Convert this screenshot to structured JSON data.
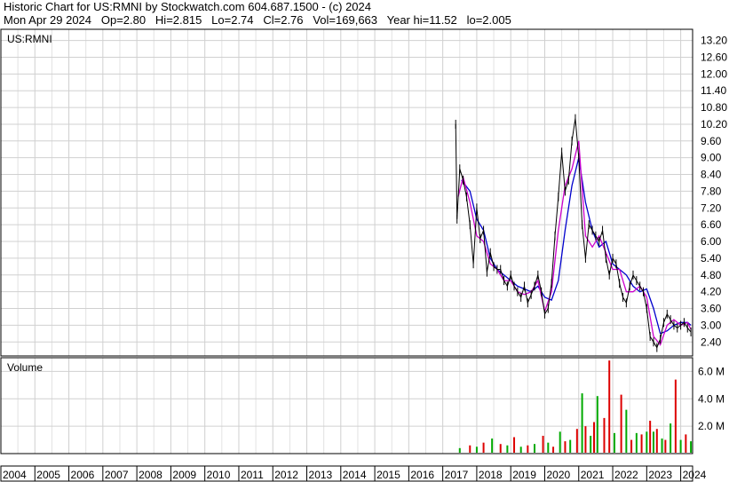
{
  "header": {
    "line1": "Historic Chart for US:RMNI by Stockwatch.com 604.687.1500 - (c) 2024",
    "line2": "Mon Apr 29 2024   Op=2.80   Hi=2.815   Lo=2.74   Cl=2.76   Vol=169,663   Year hi=11.52   lo=2.005"
  },
  "chart_data": [
    {
      "type": "line",
      "title": "US:RMNI",
      "y_ticks": [
        "13.20",
        "12.60",
        "12.00",
        "11.40",
        "10.80",
        "10.20",
        "9.60",
        "9.00",
        "8.40",
        "7.80",
        "7.20",
        "6.60",
        "6.00",
        "5.40",
        "4.80",
        "4.20",
        "3.60",
        "3.00",
        "2.40"
      ],
      "ylim": [
        1.9,
        13.6
      ],
      "x_ticks": [
        "2004",
        "2005",
        "2006",
        "2007",
        "2008",
        "2009",
        "2010",
        "2011",
        "2012",
        "2013",
        "2014",
        "2015",
        "2016",
        "2017",
        "2018",
        "2019",
        "2020",
        "2021",
        "2022",
        "2023",
        "2024"
      ],
      "xlim": [
        2004.0,
        2024.35
      ],
      "colors": {
        "price": "#000000",
        "ma_fast": "#cc00cc",
        "ma_slow": "#0000cc"
      },
      "series": [
        {
          "key": "price",
          "x": [
            2017.38,
            2017.42,
            2017.5,
            2017.6,
            2017.7,
            2017.8,
            2017.9,
            2018.0,
            2018.1,
            2018.2,
            2018.3,
            2018.4,
            2018.5,
            2018.6,
            2018.7,
            2018.8,
            2018.9,
            2019.0,
            2019.1,
            2019.2,
            2019.3,
            2019.4,
            2019.5,
            2019.6,
            2019.7,
            2019.8,
            2019.9,
            2020.0,
            2020.1,
            2020.2,
            2020.3,
            2020.4,
            2020.5,
            2020.6,
            2020.7,
            2020.8,
            2020.9,
            2021.0,
            2021.1,
            2021.2,
            2021.3,
            2021.4,
            2021.5,
            2021.6,
            2021.7,
            2021.8,
            2021.9,
            2022.0,
            2022.1,
            2022.2,
            2022.3,
            2022.4,
            2022.5,
            2022.6,
            2022.7,
            2022.8,
            2022.9,
            2023.0,
            2023.1,
            2023.2,
            2023.3,
            2023.4,
            2023.5,
            2023.6,
            2023.7,
            2023.8,
            2023.9,
            2024.0,
            2024.1,
            2024.2,
            2024.3
          ],
          "y": [
            10.2,
            6.8,
            8.6,
            8.2,
            7.6,
            6.6,
            5.2,
            7.2,
            6.1,
            6.4,
            4.9,
            5.6,
            5.1,
            5.0,
            5.0,
            4.6,
            4.4,
            4.8,
            4.4,
            4.2,
            4.0,
            4.4,
            3.8,
            4.1,
            4.4,
            4.8,
            4.2,
            3.4,
            3.6,
            4.5,
            6.2,
            7.6,
            9.2,
            7.8,
            8.2,
            9.6,
            10.4,
            9.0,
            6.6,
            5.4,
            6.6,
            6.4,
            6.2,
            6.0,
            6.4,
            5.4,
            4.8,
            5.4,
            5.2,
            4.5,
            4.0,
            3.8,
            4.4,
            4.8,
            4.6,
            4.4,
            4.2,
            3.6,
            2.6,
            2.4,
            2.2,
            2.5,
            3.1,
            3.4,
            3.2,
            3.0,
            2.9,
            3.0,
            3.1,
            2.9,
            2.76
          ]
        },
        {
          "key": "ma_fast",
          "x": [
            2017.45,
            2017.6,
            2017.8,
            2018.0,
            2018.2,
            2018.4,
            2018.6,
            2018.8,
            2019.0,
            2019.2,
            2019.4,
            2019.6,
            2019.8,
            2020.0,
            2020.2,
            2020.4,
            2020.6,
            2020.8,
            2021.0,
            2021.2,
            2021.4,
            2021.6,
            2021.8,
            2022.0,
            2022.2,
            2022.4,
            2022.6,
            2022.8,
            2023.0,
            2023.2,
            2023.4,
            2023.6,
            2023.8,
            2024.0,
            2024.2,
            2024.3
          ],
          "y": [
            7.6,
            8.3,
            7.4,
            6.2,
            6.0,
            5.2,
            5.0,
            4.6,
            4.6,
            4.2,
            4.1,
            4.2,
            4.6,
            3.5,
            4.2,
            6.4,
            8.0,
            8.6,
            9.6,
            6.2,
            5.8,
            6.2,
            5.6,
            5.0,
            5.0,
            4.2,
            4.2,
            4.4,
            4.0,
            2.6,
            2.3,
            3.0,
            3.2,
            3.0,
            3.1,
            2.85
          ]
        },
        {
          "key": "ma_slow",
          "x": [
            2017.55,
            2017.8,
            2018.0,
            2018.2,
            2018.4,
            2018.6,
            2018.8,
            2019.0,
            2019.2,
            2019.4,
            2019.6,
            2019.8,
            2020.0,
            2020.2,
            2020.4,
            2020.6,
            2020.8,
            2021.0,
            2021.2,
            2021.4,
            2021.6,
            2021.8,
            2022.0,
            2022.2,
            2022.4,
            2022.6,
            2022.8,
            2023.0,
            2023.2,
            2023.4,
            2023.6,
            2023.8,
            2024.0,
            2024.2,
            2024.3
          ],
          "y": [
            8.2,
            7.8,
            6.8,
            6.4,
            5.4,
            5.0,
            4.8,
            4.6,
            4.4,
            4.3,
            4.2,
            4.4,
            4.0,
            3.9,
            4.6,
            6.4,
            8.0,
            9.0,
            7.4,
            6.4,
            5.8,
            6.0,
            5.2,
            5.0,
            4.8,
            4.4,
            4.2,
            4.3,
            3.6,
            2.7,
            2.8,
            3.0,
            3.1,
            3.1,
            3.0
          ]
        }
      ]
    },
    {
      "type": "bar",
      "title": "Volume",
      "y_ticks": [
        "6.0 M",
        "4.0 M",
        "2.0 M"
      ],
      "ylim": [
        0,
        7.0
      ],
      "colors": {
        "up": "#00aa00",
        "down": "#dd0000"
      },
      "series": [
        {
          "name": "",
          "x": [
            2017.5,
            2017.8,
            2018.0,
            2018.2,
            2018.45,
            2018.7,
            2018.9,
            2019.1,
            2019.3,
            2019.5,
            2019.7,
            2019.95,
            2020.1,
            2020.25,
            2020.45,
            2020.6,
            2020.75,
            2020.95,
            2021.1,
            2021.2,
            2021.35,
            2021.45,
            2021.55,
            2021.75,
            2021.9,
            2022.05,
            2022.25,
            2022.4,
            2022.55,
            2022.7,
            2022.85,
            2023.0,
            2023.1,
            2023.2,
            2023.3,
            2023.45,
            2023.55,
            2023.7,
            2023.85,
            2024.0,
            2024.15,
            2024.3
          ],
          "values": [
            0.4,
            0.6,
            0.5,
            0.8,
            1.1,
            0.7,
            0.6,
            1.2,
            0.5,
            0.6,
            0.7,
            1.3,
            0.8,
            0.5,
            1.6,
            0.9,
            1.0,
            1.8,
            4.4,
            2.0,
            1.3,
            2.3,
            4.2,
            2.6,
            6.8,
            1.5,
            4.3,
            3.2,
            1.0,
            1.5,
            1.4,
            1.6,
            2.4,
            1.6,
            1.8,
            1.1,
            1.0,
            2.2,
            5.4,
            1.0,
            1.4,
            0.9
          ],
          "dir": [
            "u",
            "d",
            "u",
            "d",
            "u",
            "d",
            "u",
            "d",
            "u",
            "d",
            "u",
            "d",
            "u",
            "d",
            "u",
            "d",
            "u",
            "d",
            "u",
            "d",
            "u",
            "d",
            "u",
            "d",
            "d",
            "u",
            "d",
            "u",
            "d",
            "u",
            "d",
            "u",
            "d",
            "u",
            "d",
            "u",
            "d",
            "u",
            "d",
            "u",
            "d",
            "u"
          ]
        }
      ]
    }
  ]
}
